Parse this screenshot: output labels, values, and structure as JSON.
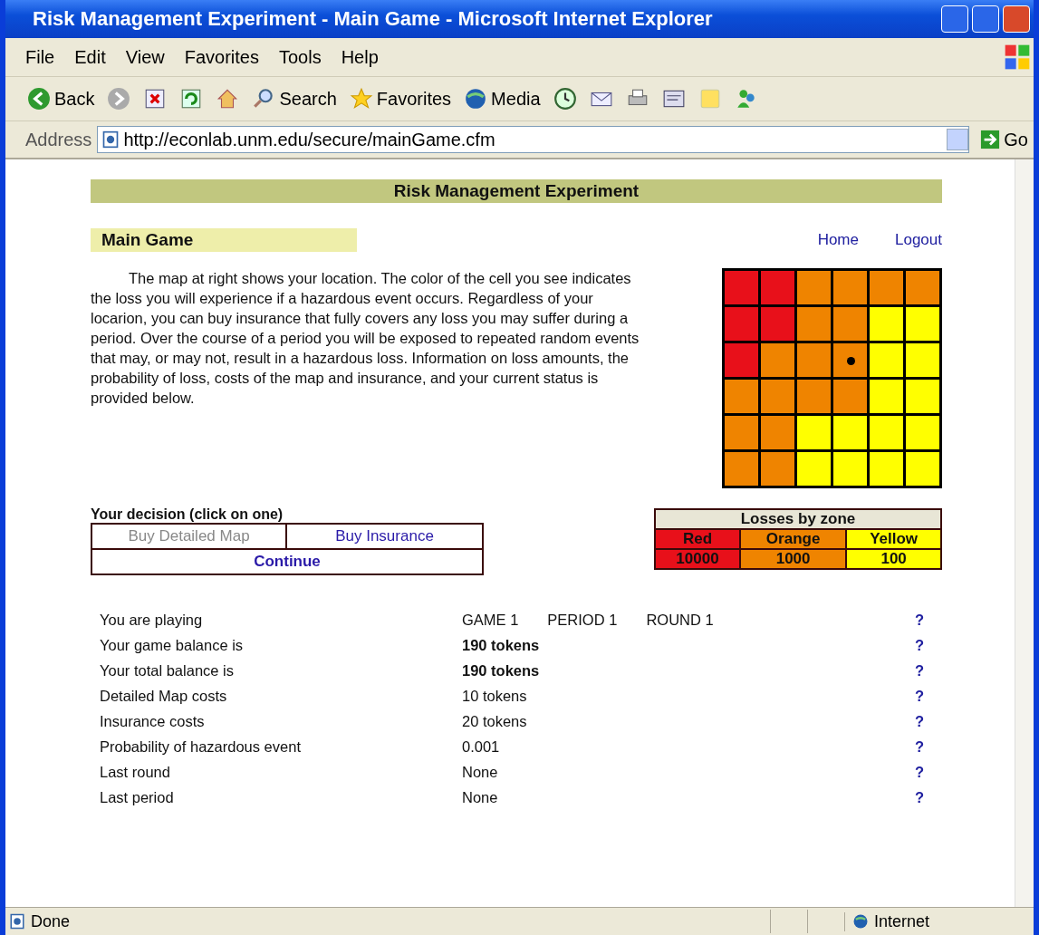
{
  "window": {
    "title": "Risk Management Experiment - Main Game - Microsoft Internet Explorer"
  },
  "menu": [
    "File",
    "Edit",
    "View",
    "Favorites",
    "Tools",
    "Help"
  ],
  "toolbar": [
    {
      "kind": "back",
      "label": "Back"
    },
    {
      "kind": "forward"
    },
    {
      "kind": "stop"
    },
    {
      "kind": "refresh"
    },
    {
      "kind": "home"
    },
    {
      "kind": "search",
      "label": "Search"
    },
    {
      "kind": "favorites",
      "label": "Favorites"
    },
    {
      "kind": "media",
      "label": "Media"
    },
    {
      "kind": "history"
    },
    {
      "kind": "mail"
    },
    {
      "kind": "print"
    },
    {
      "kind": "edit"
    },
    {
      "kind": "note"
    },
    {
      "kind": "messenger"
    }
  ],
  "address": {
    "label": "Address",
    "value": "http://econlab.unm.edu/secure/mainGame.cfm",
    "go": "Go"
  },
  "page": {
    "banner": "Risk Management Experiment",
    "heading": "Main Game",
    "links": [
      "Home",
      "Logout"
    ],
    "intro": "The map at right shows your location. The color of the cell you see indicates the loss you will experience if a hazardous event occurs. Regardless of your locarion, you can buy insurance that fully covers any loss you may suffer during a period. Over the course of a period you will be exposed to repeated random events that may, or may not, result in a hazardous loss. Information on loss amounts, the probability of loss, costs of the map and insurance, and your current status is provided below.",
    "map": [
      [
        {
          "color": "#e8101a",
          "marked": false
        },
        {
          "color": "#e8101a",
          "marked": false
        },
        {
          "color": "#ef8400",
          "marked": false
        },
        {
          "color": "#ef8400",
          "marked": false
        },
        {
          "color": "#ef8400",
          "marked": false
        },
        {
          "color": "#ef8400",
          "marked": false
        }
      ],
      [
        {
          "color": "#e8101a",
          "marked": false
        },
        {
          "color": "#e8101a",
          "marked": false
        },
        {
          "color": "#ef8400",
          "marked": false
        },
        {
          "color": "#ef8400",
          "marked": false
        },
        {
          "color": "#ffff00",
          "marked": false
        },
        {
          "color": "#ffff00",
          "marked": false
        }
      ],
      [
        {
          "color": "#e8101a",
          "marked": false
        },
        {
          "color": "#ef8400",
          "marked": false
        },
        {
          "color": "#ef8400",
          "marked": false
        },
        {
          "color": "#ef8400",
          "marked": true
        },
        {
          "color": "#ffff00",
          "marked": false
        },
        {
          "color": "#ffff00",
          "marked": false
        }
      ],
      [
        {
          "color": "#ef8400",
          "marked": false
        },
        {
          "color": "#ef8400",
          "marked": false
        },
        {
          "color": "#ef8400",
          "marked": false
        },
        {
          "color": "#ef8400",
          "marked": false
        },
        {
          "color": "#ffff00",
          "marked": false
        },
        {
          "color": "#ffff00",
          "marked": false
        }
      ],
      [
        {
          "color": "#ef8400",
          "marked": false
        },
        {
          "color": "#ef8400",
          "marked": false
        },
        {
          "color": "#ffff00",
          "marked": false
        },
        {
          "color": "#ffff00",
          "marked": false
        },
        {
          "color": "#ffff00",
          "marked": false
        },
        {
          "color": "#ffff00",
          "marked": false
        }
      ],
      [
        {
          "color": "#ef8400",
          "marked": false
        },
        {
          "color": "#ef8400",
          "marked": false
        },
        {
          "color": "#ffff00",
          "marked": false
        },
        {
          "color": "#ffff00",
          "marked": false
        },
        {
          "color": "#ffff00",
          "marked": false
        },
        {
          "color": "#ffff00",
          "marked": false
        }
      ]
    ],
    "decision": {
      "label": "Your decision (click on one)",
      "buttons": [
        {
          "label": "Buy Detailed Map",
          "disabled": true
        },
        {
          "label": "Buy Insurance",
          "disabled": false
        },
        {
          "label": "Continue",
          "disabled": false
        }
      ]
    },
    "losses": {
      "title": "Losses by zone",
      "zones": [
        {
          "name": "Red",
          "amount": "10000",
          "color": "#e8101a"
        },
        {
          "name": "Orange",
          "amount": "1000",
          "color": "#ef8400"
        },
        {
          "name": "Yellow",
          "amount": "100",
          "color": "#ffff00"
        }
      ]
    },
    "status": [
      {
        "label": "You are playing",
        "values": [
          "GAME 1",
          "PERIOD 1",
          "ROUND 1"
        ],
        "bold": false,
        "help": "?"
      },
      {
        "label": "Your game balance is",
        "values": [
          "190 tokens"
        ],
        "bold": true,
        "help": "?"
      },
      {
        "label": "Your total balance is",
        "values": [
          "190 tokens"
        ],
        "bold": true,
        "help": "?"
      },
      {
        "label": "Detailed Map costs",
        "values": [
          "10 tokens"
        ],
        "bold": false,
        "help": "?"
      },
      {
        "label": "Insurance costs",
        "values": [
          "20 tokens"
        ],
        "bold": false,
        "help": "?"
      },
      {
        "label": "Probability of hazardous event",
        "values": [
          "0.001"
        ],
        "bold": false,
        "help": "?"
      },
      {
        "label": "Last round",
        "values": [
          "None"
        ],
        "bold": false,
        "help": "?"
      },
      {
        "label": "Last period",
        "values": [
          "None"
        ],
        "bold": false,
        "help": "?"
      }
    ]
  },
  "status_bar": {
    "text": "Done",
    "zone": "Internet"
  }
}
